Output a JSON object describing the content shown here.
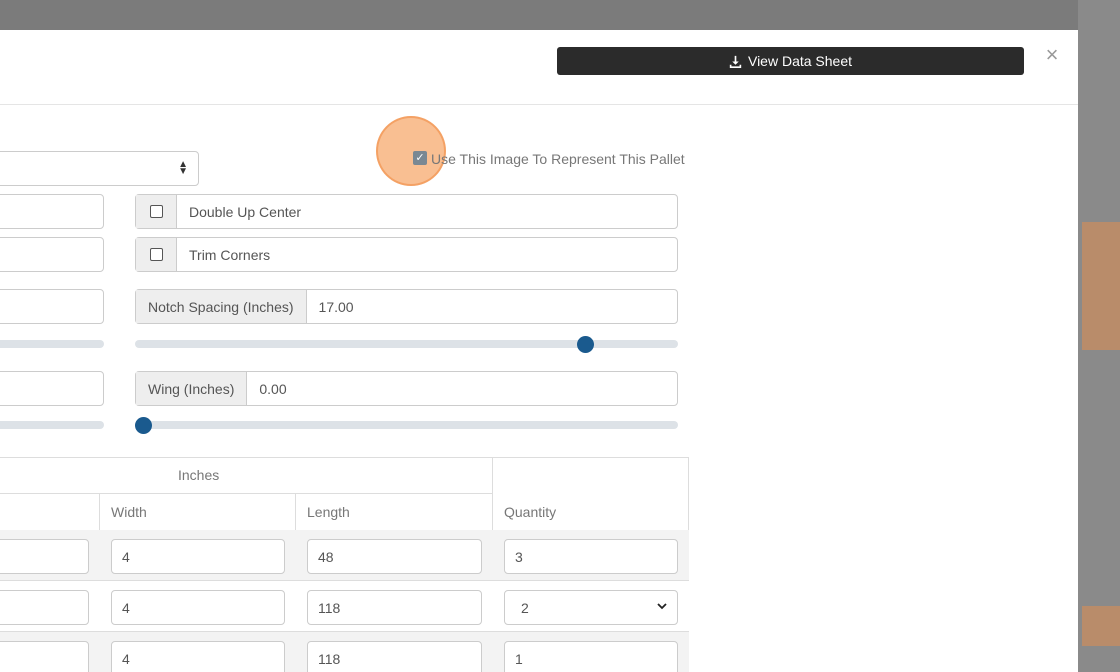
{
  "header": {
    "datasheet_label": "View Data Sheet",
    "close_glyph": "×"
  },
  "image_option": {
    "checked": true,
    "label": "Use This Image To Represent This Pallet"
  },
  "options": {
    "double_up_center": {
      "label": "Double Up Center",
      "checked": false
    },
    "trim_corners": {
      "label": "Trim Corners",
      "checked": false
    },
    "notch_spacing": {
      "label": "Notch Spacing (Inches)",
      "value": "17.00",
      "slider_level": 0.84
    },
    "wing": {
      "label": "Wing (Inches)",
      "value": "0.00",
      "slider_level": 0.0
    }
  },
  "table": {
    "group_header": "Inches",
    "columns": {
      "width": "Width",
      "length": "Length",
      "quantity": "Quantity"
    },
    "rows": [
      {
        "width": "4",
        "length": "48",
        "quantity": "3"
      },
      {
        "width": "4",
        "length": "118",
        "quantity": "2"
      },
      {
        "width": "4",
        "length": "118",
        "quantity": "1"
      }
    ]
  },
  "colors": {
    "primary_dark": "#2b2b2b",
    "slider_thumb": "#1a5a8e",
    "focus_highlight": "#f7aa6e"
  },
  "icons": {
    "download": "download-icon",
    "close": "close-icon",
    "check": "check-icon",
    "select_arrows": "sort-arrows-icon",
    "dropdown": "chevron-down-icon"
  }
}
